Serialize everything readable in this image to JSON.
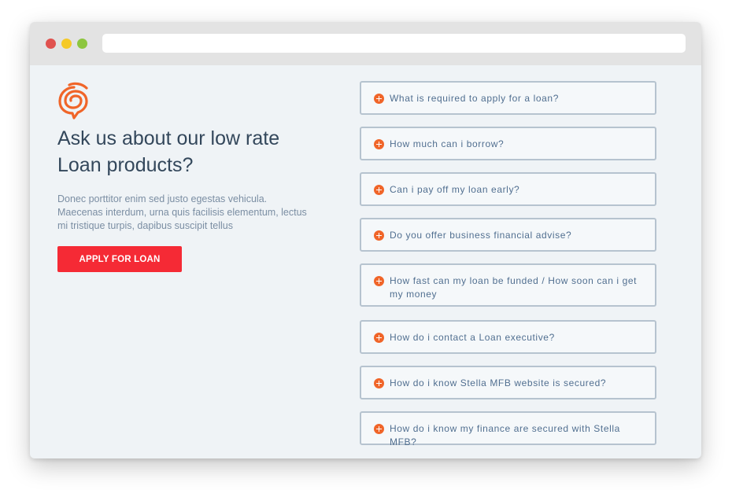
{
  "page": {
    "headline_line1": "Ask us about our low rate",
    "headline_line2": "Loan products?",
    "description": "Donec porttitor enim sed justo egestas vehicula. Maecenas interdum, urna quis facilisis elementum, lectus mi tristique turpis, dapibus suscipit tellus",
    "apply_button_label": "APPLY FOR LOAN"
  },
  "logo": {
    "icon": "speech-bubble-logo-icon",
    "color": "#f06529"
  },
  "faq": {
    "items": [
      {
        "question": "What is required to apply for a loan?"
      },
      {
        "question": "How much can i borrow?"
      },
      {
        "question": "Can i pay off my loan early?"
      },
      {
        "question": "Do you offer business financial advise?"
      },
      {
        "question": "How fast can my loan be funded / How soon can i get my money"
      },
      {
        "question": "How do i contact a Loan executive?"
      },
      {
        "question": "How do i know Stella MFB website is secured?"
      },
      {
        "question": "How do i know my finance are secured with Stella MFB?"
      }
    ]
  },
  "colors": {
    "accent": "#f52a35",
    "icon_orange": "#f06529",
    "heading": "#33475b",
    "text_muted": "#7b8ea3",
    "border": "#b6c3cf",
    "background": "#eff3f6"
  }
}
